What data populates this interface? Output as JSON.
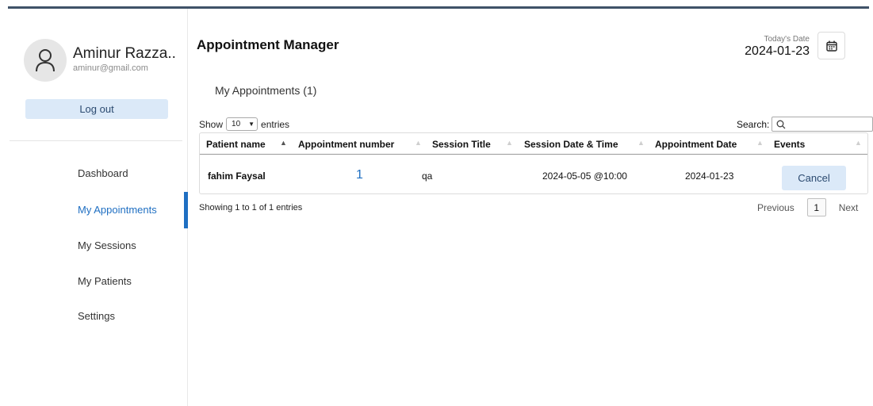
{
  "user": {
    "name": "Aminur Razza..",
    "email": "aminur@gmail.com"
  },
  "sidebar": {
    "logout_label": "Log out",
    "items": [
      {
        "label": "Dashboard",
        "active": false
      },
      {
        "label": "My Appointments",
        "active": true
      },
      {
        "label": "My Sessions",
        "active": false
      },
      {
        "label": "My Patients",
        "active": false
      },
      {
        "label": "Settings",
        "active": false
      }
    ]
  },
  "header": {
    "title": "Appointment Manager",
    "today_label": "Today's Date",
    "today_value": "2024-01-23",
    "calendar_icon": "calendar-icon"
  },
  "main": {
    "section_title": "My Appointments (1)",
    "length": {
      "prefix": "Show",
      "value": "10",
      "suffix": "entries"
    },
    "search": {
      "label": "Search:",
      "value": ""
    },
    "table": {
      "columns": [
        "Patient name",
        "Appointment number",
        "Session Title",
        "Session Date & Time",
        "Appointment Date",
        "Events"
      ],
      "rows": [
        {
          "patient": "fahim Faysal",
          "number": "1",
          "session_title": "qa",
          "session_datetime": "2024-05-05 @10:00",
          "appointment_date": "2024-01-23",
          "action": "Cancel"
        }
      ]
    },
    "info": "Showing 1 to 1 of 1 entries",
    "pagination": {
      "previous": "Previous",
      "current": "1",
      "next": "Next"
    }
  },
  "colors": {
    "accent": "#1f6fc2",
    "button_bg": "#dbe9f8",
    "topbar": "#3f5268"
  }
}
